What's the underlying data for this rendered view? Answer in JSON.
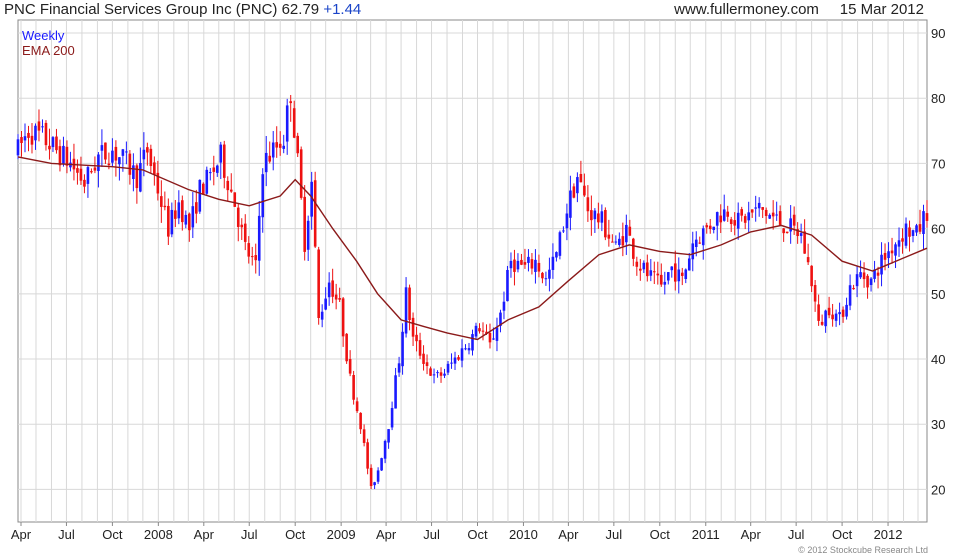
{
  "header": {
    "title": "PNC Financial Services Group Inc (PNC)",
    "price": "62.79",
    "change": "+1.44",
    "site": "www.fullermoney.com",
    "date": "15 Mar 2012"
  },
  "copyright": "© 2012 Stockcube Research Ltd",
  "colors": {
    "up": "#1a1aff",
    "down": "#ee1111",
    "ema": "#8b1a1a",
    "grid": "#d8d8d8",
    "frame": "#888888"
  },
  "chart_data": {
    "type": "candlestick",
    "interval": "Weekly",
    "ylim": [
      15,
      92
    ],
    "yticks": [
      20,
      30,
      40,
      50,
      60,
      70,
      80,
      90
    ],
    "xlim": [
      "2007-03-26",
      "2012-03-19"
    ],
    "xticks": [
      {
        "date": "2007-04-01",
        "label": "Apr"
      },
      {
        "date": "2007-07-01",
        "label": "Jul"
      },
      {
        "date": "2007-10-01",
        "label": "Oct"
      },
      {
        "date": "2008-01-01",
        "label": "2008"
      },
      {
        "date": "2008-04-01",
        "label": "Apr"
      },
      {
        "date": "2008-07-01",
        "label": "Jul"
      },
      {
        "date": "2008-10-01",
        "label": "Oct"
      },
      {
        "date": "2009-01-01",
        "label": "2009"
      },
      {
        "date": "2009-04-01",
        "label": "Apr"
      },
      {
        "date": "2009-07-01",
        "label": "Jul"
      },
      {
        "date": "2009-10-01",
        "label": "Oct"
      },
      {
        "date": "2010-01-01",
        "label": "2010"
      },
      {
        "date": "2010-04-01",
        "label": "Apr"
      },
      {
        "date": "2010-07-01",
        "label": "Jul"
      },
      {
        "date": "2010-10-01",
        "label": "Oct"
      },
      {
        "date": "2011-01-01",
        "label": "2011"
      },
      {
        "date": "2011-04-01",
        "label": "Apr"
      },
      {
        "date": "2011-07-01",
        "label": "Jul"
      },
      {
        "date": "2011-10-01",
        "label": "Oct"
      },
      {
        "date": "2012-01-01",
        "label": "2012"
      }
    ],
    "legend": [
      {
        "label": "Weekly",
        "color": "#1a1aff"
      },
      {
        "label": "EMA 200",
        "color": "#8b1a1a"
      }
    ],
    "price_path": [
      [
        "2007-03-26",
        72
      ],
      [
        "2007-04-16",
        75
      ],
      [
        "2007-05-14",
        74
      ],
      [
        "2007-06-11",
        72
      ],
      [
        "2007-07-09",
        70
      ],
      [
        "2007-08-06",
        67
      ],
      [
        "2007-09-03",
        71
      ],
      [
        "2007-10-01",
        72
      ],
      [
        "2007-10-29",
        70
      ],
      [
        "2007-11-19",
        68
      ],
      [
        "2007-12-10",
        72
      ],
      [
        "2007-12-31",
        66
      ],
      [
        "2008-01-21",
        60
      ],
      [
        "2008-02-11",
        64
      ],
      [
        "2008-03-03",
        60
      ],
      [
        "2008-03-24",
        66
      ],
      [
        "2008-04-14",
        68
      ],
      [
        "2008-05-05",
        71
      ],
      [
        "2008-06-02",
        64
      ],
      [
        "2008-06-23",
        57
      ],
      [
        "2008-07-14",
        54
      ],
      [
        "2008-07-28",
        70
      ],
      [
        "2008-08-18",
        72
      ],
      [
        "2008-09-08",
        74
      ],
      [
        "2008-09-22",
        81
      ],
      [
        "2008-10-06",
        70
      ],
      [
        "2008-10-20",
        58
      ],
      [
        "2008-11-03",
        67
      ],
      [
        "2008-11-17",
        46
      ],
      [
        "2008-12-08",
        52
      ],
      [
        "2008-12-29",
        48
      ],
      [
        "2009-01-19",
        37
      ],
      [
        "2009-02-09",
        30
      ],
      [
        "2009-03-02",
        20
      ],
      [
        "2009-03-16",
        23
      ],
      [
        "2009-04-06",
        30
      ],
      [
        "2009-04-27",
        40
      ],
      [
        "2009-05-11",
        50
      ],
      [
        "2009-05-25",
        43
      ],
      [
        "2009-06-15",
        40
      ],
      [
        "2009-07-06",
        37
      ],
      [
        "2009-07-27",
        38
      ],
      [
        "2009-08-17",
        40
      ],
      [
        "2009-09-07",
        42
      ],
      [
        "2009-10-05",
        45
      ],
      [
        "2009-10-26",
        42
      ],
      [
        "2009-11-16",
        47
      ],
      [
        "2009-12-07",
        55
      ],
      [
        "2010-01-04",
        54
      ],
      [
        "2010-01-25",
        55
      ],
      [
        "2010-02-15",
        52
      ],
      [
        "2010-03-08",
        56
      ],
      [
        "2010-03-29",
        63
      ],
      [
        "2010-04-19",
        68
      ],
      [
        "2010-05-10",
        63
      ],
      [
        "2010-06-07",
        61
      ],
      [
        "2010-07-05",
        57
      ],
      [
        "2010-07-26",
        60
      ],
      [
        "2010-08-16",
        55
      ],
      [
        "2010-09-06",
        53
      ],
      [
        "2010-10-04",
        51
      ],
      [
        "2010-10-25",
        54
      ],
      [
        "2010-11-15",
        52
      ],
      [
        "2010-12-06",
        58
      ],
      [
        "2011-01-03",
        60
      ],
      [
        "2011-01-24",
        62
      ],
      [
        "2011-02-14",
        63
      ],
      [
        "2011-03-07",
        61
      ],
      [
        "2011-03-28",
        62
      ],
      [
        "2011-04-18",
        63
      ],
      [
        "2011-05-09",
        62
      ],
      [
        "2011-05-30",
        61
      ],
      [
        "2011-06-20",
        60
      ],
      [
        "2011-07-11",
        59
      ],
      [
        "2011-08-01",
        52
      ],
      [
        "2011-08-15",
        45
      ],
      [
        "2011-09-05",
        48
      ],
      [
        "2011-09-26",
        46
      ],
      [
        "2011-10-17",
        51
      ],
      [
        "2011-11-07",
        53
      ],
      [
        "2011-11-28",
        52
      ],
      [
        "2011-12-19",
        55
      ],
      [
        "2012-01-16",
        58
      ],
      [
        "2012-02-06",
        60
      ],
      [
        "2012-02-27",
        59
      ],
      [
        "2012-03-19",
        62.79
      ]
    ],
    "ema200": [
      [
        "2007-03-26",
        71
      ],
      [
        "2007-06-01",
        70
      ],
      [
        "2007-10-01",
        69.5
      ],
      [
        "2007-12-01",
        69
      ],
      [
        "2008-03-01",
        66
      ],
      [
        "2008-05-01",
        64.5
      ],
      [
        "2008-07-01",
        63.5
      ],
      [
        "2008-09-01",
        65
      ],
      [
        "2008-10-01",
        67.5
      ],
      [
        "2008-11-01",
        65
      ],
      [
        "2008-12-15",
        60
      ],
      [
        "2009-02-01",
        55
      ],
      [
        "2009-03-15",
        50
      ],
      [
        "2009-05-01",
        46
      ],
      [
        "2009-06-15",
        45
      ],
      [
        "2009-08-01",
        44
      ],
      [
        "2009-10-01",
        43
      ],
      [
        "2009-12-01",
        46
      ],
      [
        "2010-02-01",
        48
      ],
      [
        "2010-04-01",
        52
      ],
      [
        "2010-06-01",
        56
      ],
      [
        "2010-08-01",
        57.5
      ],
      [
        "2010-10-01",
        56.5
      ],
      [
        "2010-12-01",
        56
      ],
      [
        "2011-02-01",
        57.5
      ],
      [
        "2011-04-01",
        59.5
      ],
      [
        "2011-06-01",
        60.5
      ],
      [
        "2011-08-01",
        59
      ],
      [
        "2011-10-01",
        55
      ],
      [
        "2011-12-01",
        53.5
      ],
      [
        "2012-02-01",
        55.5
      ],
      [
        "2012-03-19",
        57
      ]
    ]
  }
}
